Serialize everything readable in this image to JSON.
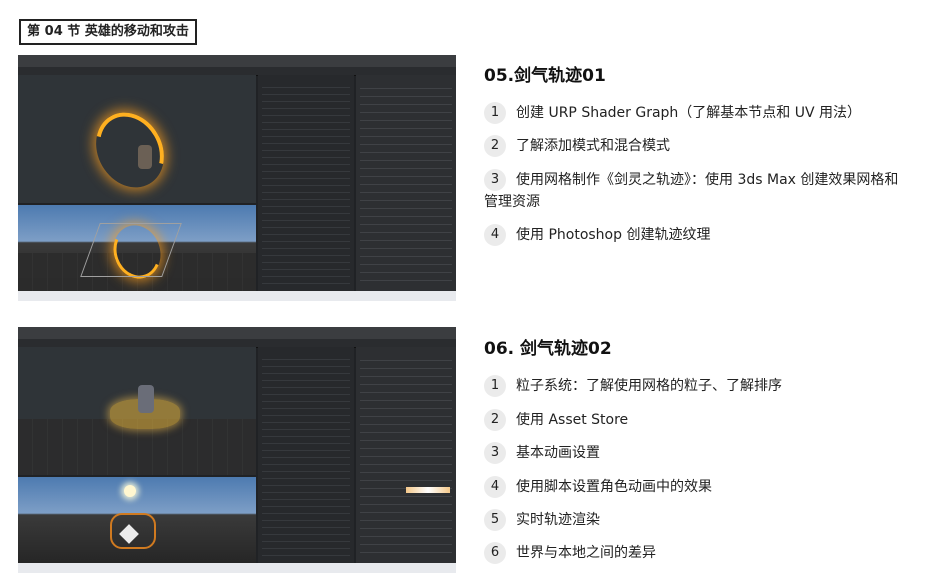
{
  "section": {
    "title": "第 04 节 英雄的移动和攻击"
  },
  "lessons": [
    {
      "heading": "05.剑气轨迹01",
      "items": [
        {
          "num": "1",
          "text": "创建 URP Shader Graph（了解基本节点和 UV 用法）"
        },
        {
          "num": "2",
          "text": "了解添加模式和混合模式"
        },
        {
          "num": "3",
          "text": "使用网格制作《剑灵之轨迹》：使用 3ds Max 创建效果网格和"
        },
        {
          "text": "管理资源"
        },
        {
          "num": "4",
          "text": "使用 Photoshop 创建轨迹纹理"
        }
      ]
    },
    {
      "heading": "06. 剑气轨迹02",
      "items": [
        {
          "num": "1",
          "text": "粒子系统：了解使用网格的粒子、了解排序"
        },
        {
          "num": "2",
          "text": "使用 Asset Store"
        },
        {
          "num": "3",
          "text": "基本动画设置"
        },
        {
          "num": "4",
          "text": "使用脚本设置角色动画中的效果"
        },
        {
          "num": "5",
          "text": "实时轨迹渲染"
        },
        {
          "num": "6",
          "text": "世界与本地之间的差异"
        }
      ]
    }
  ]
}
